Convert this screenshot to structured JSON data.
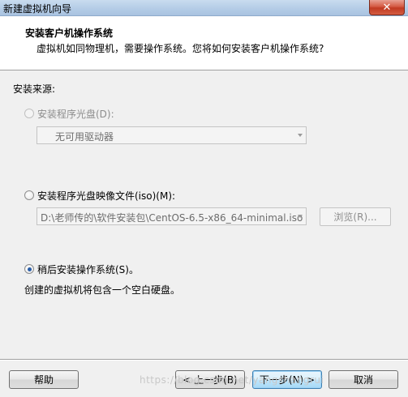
{
  "window": {
    "title": "新建虚拟机向导",
    "close_label": "✕"
  },
  "header": {
    "title": "安装客户机操作系统",
    "subtitle": "虚拟机如同物理机，需要操作系统。您将如何安装客户机操作系统?"
  },
  "install_source": {
    "label": "安装来源:",
    "optical": {
      "label": "安装程序光盘(D):",
      "selected": false,
      "enabled": false,
      "dropdown_value": "无可用驱动器"
    },
    "iso": {
      "label": "安装程序光盘映像文件(iso)(M):",
      "selected": false,
      "enabled": false,
      "path_value": "D:\\老师传的\\软件安装包\\CentOS-6.5-x86_64-minimal.iso",
      "browse_label": "浏览(R)..."
    },
    "later": {
      "label": "稍后安装操作系统(S)。",
      "selected": true,
      "description": "创建的虚拟机将包含一个空白硬盘。"
    }
  },
  "footer": {
    "help_label": "帮助",
    "back_label": "< 上一步(B)",
    "next_label": "下一步(N) >",
    "cancel_label": "取消",
    "watermark": "https://blog.csdn.net/yangshangrui"
  }
}
